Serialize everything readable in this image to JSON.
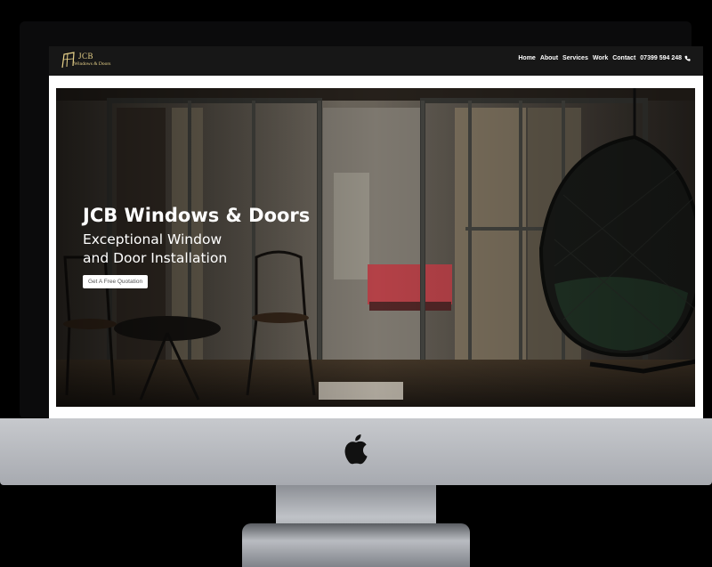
{
  "site": {
    "logo_title": "JCB",
    "logo_sub": "Windows & Doors"
  },
  "nav": {
    "items": [
      "Home",
      "About",
      "Services",
      "Work",
      "Contact"
    ],
    "phone": "07399 594 248"
  },
  "hero": {
    "title": "JCB Windows & Doors",
    "subtitle_line1": "Exceptional Window",
    "subtitle_line2": "and Door Installation",
    "cta": "Get A Free Quotation"
  },
  "colors": {
    "navbar": "#171717",
    "logo_gold": "#e8d28a",
    "device_silver": "#bfc2c7"
  },
  "icons": [
    "logo-window-icon",
    "phone-icon",
    "apple-logo-icon"
  ]
}
